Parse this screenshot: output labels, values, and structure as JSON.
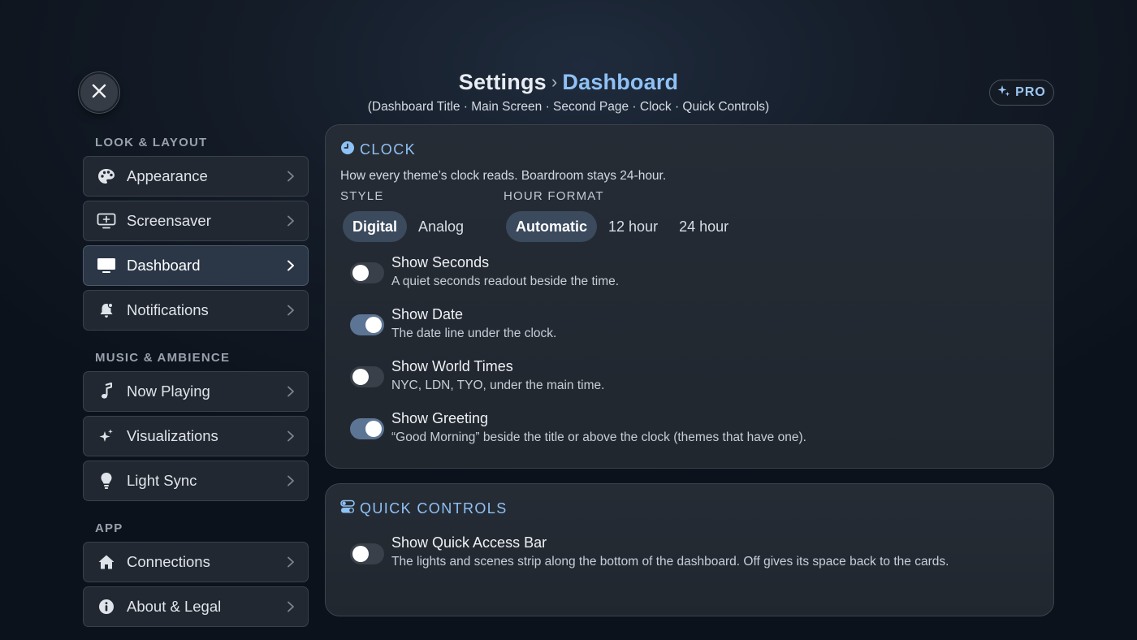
{
  "header": {
    "title": "Settings",
    "separator": "›",
    "current": "Dashboard",
    "subtitle": "(Dashboard Title · Main Screen · Second Page · Clock · Quick Controls)",
    "pro_label": "PRO"
  },
  "sidebar": {
    "sections": [
      {
        "label": "LOOK & LAYOUT",
        "items": [
          {
            "label": "Appearance",
            "icon": "palette-icon"
          },
          {
            "label": "Screensaver",
            "icon": "screensaver-icon"
          },
          {
            "label": "Dashboard",
            "icon": "monitor-icon",
            "active": true
          },
          {
            "label": "Notifications",
            "icon": "bell-icon"
          }
        ]
      },
      {
        "label": "MUSIC & AMBIENCE",
        "items": [
          {
            "label": "Now Playing",
            "icon": "music-note-icon"
          },
          {
            "label": "Visualizations",
            "icon": "sparkle-icon"
          },
          {
            "label": "Light Sync",
            "icon": "lightbulb-icon"
          }
        ]
      },
      {
        "label": "APP",
        "items": [
          {
            "label": "Connections",
            "icon": "home-icon"
          },
          {
            "label": "About & Legal",
            "icon": "info-icon"
          }
        ]
      }
    ]
  },
  "clock": {
    "title": "CLOCK",
    "description": "How every theme’s clock reads. Boardroom stays 24-hour.",
    "style_label": "STYLE",
    "style_options": [
      "Digital",
      "Analog"
    ],
    "style_selected": "Digital",
    "hour_label": "HOUR FORMAT",
    "hour_options": [
      "Automatic",
      "12 hour",
      "24 hour"
    ],
    "hour_selected": "Automatic",
    "toggles": [
      {
        "label": "Show Seconds",
        "desc": "A quiet seconds readout beside the time.",
        "on": false
      },
      {
        "label": "Show Date",
        "desc": "The date line under the clock.",
        "on": true
      },
      {
        "label": "Show World Times",
        "desc": "NYC, LDN, TYO, under the main time.",
        "on": false
      },
      {
        "label": "Show Greeting",
        "desc": "“Good Morning” beside the title or above the clock (themes that have one).",
        "on": true
      }
    ]
  },
  "quick_controls": {
    "title": "QUICK CONTROLS",
    "toggles": [
      {
        "label": "Show Quick Access Bar",
        "desc": "The lights and scenes strip along the bottom of the dashboard. Off gives its space back to the cards.",
        "on": false
      }
    ]
  },
  "colors": {
    "accent": "#8fc1f5",
    "toggle_on": "#5d7594",
    "toggle_off": "#3a4049",
    "segment_selected": "#3b4a5d"
  }
}
